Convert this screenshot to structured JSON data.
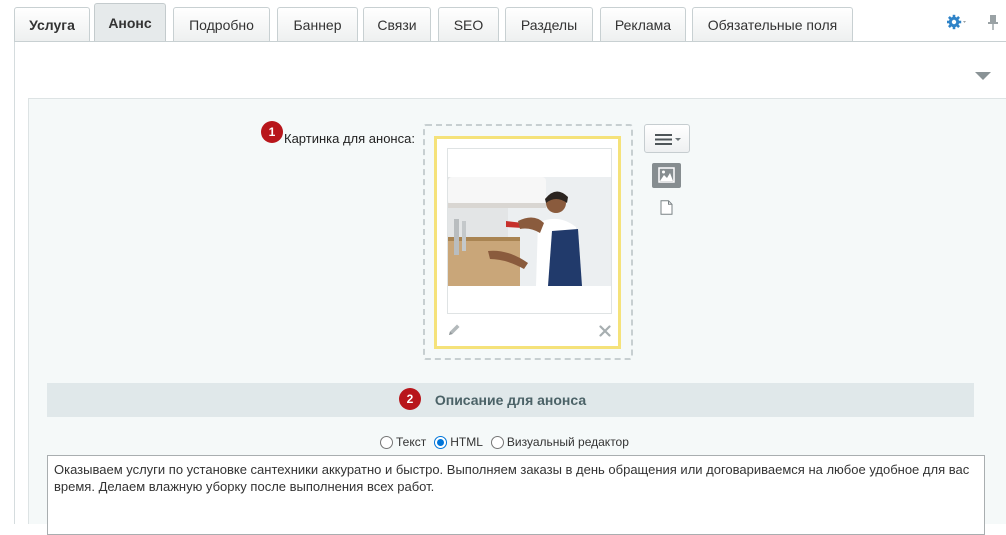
{
  "tabs": [
    {
      "label": "Услуга"
    },
    {
      "label": "Анонс"
    },
    {
      "label": "Подробно"
    },
    {
      "label": "Баннер"
    },
    {
      "label": "Связи"
    },
    {
      "label": "SEO"
    },
    {
      "label": "Разделы"
    },
    {
      "label": "Реклама"
    },
    {
      "label": "Обязательные поля"
    }
  ],
  "active_tab": "Анонс",
  "icons": {
    "settings": "gear-icon",
    "pin": "pin-icon",
    "collapse": "triangle-down-icon",
    "edit": "pencil-icon",
    "delete": "close-icon",
    "menu": "hamburger-icon",
    "image": "image-icon",
    "file": "file-icon"
  },
  "colors": {
    "badge": "#b8161b",
    "section_header_bg": "#e0e8ea",
    "image_card_border": "#f5e27a",
    "radio_accent": "#0075d9",
    "settings_icon": "#2f83c8"
  },
  "annotations": {
    "one": "1",
    "two": "2"
  },
  "preview_image": {
    "label": "Картинка для анонса:"
  },
  "description": {
    "title": "Описание для анонса",
    "modes": [
      {
        "label": "Текст",
        "checked": false
      },
      {
        "label": "HTML",
        "checked": true
      },
      {
        "label": "Визуальный редактор",
        "checked": false
      }
    ],
    "text": "Оказываем услуги по установке сантехники аккуратно и быстро. Выполняем заказы в день обращения или договариваемся на любое удобное для вас время. Делаем влажную уборку после выполнения всех работ."
  }
}
